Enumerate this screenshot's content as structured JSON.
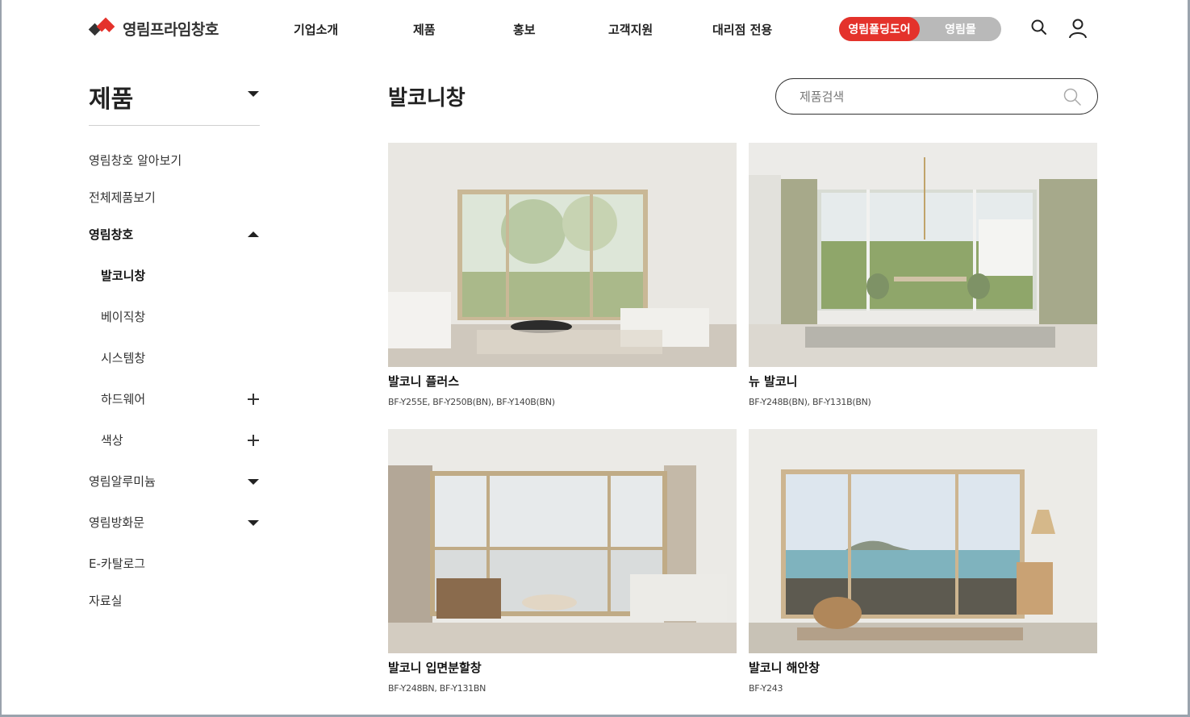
{
  "header": {
    "logo_text": "영림프라임창호",
    "nav": [
      "기업소개",
      "제품",
      "홍보",
      "고객지원",
      "대리점 전용"
    ],
    "switch_active": "영림폴딩도어",
    "switch_other": "영림몰",
    "brand_color": "#e4322b"
  },
  "sidebar": {
    "title": "제품",
    "items": {
      "about": "영림창호 알아보기",
      "all": "전체제품보기",
      "windows": "영림창호",
      "balcony": "발코니창",
      "basic": "베이직창",
      "system": "시스템창",
      "hardware": "하드웨어",
      "color": "색상",
      "aluminum": "영림알루미늄",
      "door": "영림방화문",
      "catalog": "E-카탈로그",
      "archive": "자료실"
    }
  },
  "main": {
    "title": "발코니창",
    "search_placeholder": "제품검색",
    "products": [
      {
        "name": "발코니 플러스",
        "code": "BF-Y255E, BF-Y250B(BN), BF-Y140B(BN)"
      },
      {
        "name": "뉴 발코니",
        "code": "BF-Y248B(BN), BF-Y131B(BN)"
      },
      {
        "name": "발코니 입면분할창",
        "code": "BF-Y248BN, BF-Y131BN"
      },
      {
        "name": "발코니 해안창",
        "code": "BF-Y243"
      }
    ]
  },
  "icons": {
    "search": "search-icon",
    "user": "user-icon",
    "logo": "logo-mark-icon"
  }
}
